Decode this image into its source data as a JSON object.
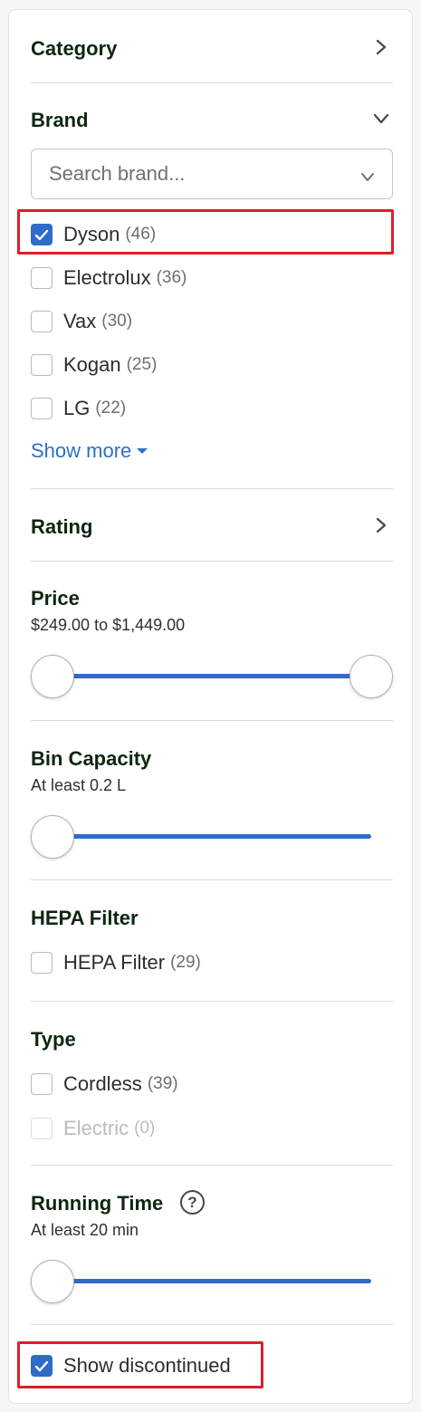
{
  "category": {
    "title": "Category"
  },
  "brand": {
    "title": "Brand",
    "search_placeholder": "Search brand...",
    "options": [
      {
        "label": "Dyson",
        "count": "(46)",
        "checked": true
      },
      {
        "label": "Electrolux",
        "count": "(36)",
        "checked": false
      },
      {
        "label": "Vax",
        "count": "(30)",
        "checked": false
      },
      {
        "label": "Kogan",
        "count": "(25)",
        "checked": false
      },
      {
        "label": "LG",
        "count": "(22)",
        "checked": false
      }
    ],
    "show_more": "Show more"
  },
  "rating": {
    "title": "Rating"
  },
  "price": {
    "title": "Price",
    "range_text": "$249.00 to $1,449.00",
    "min_fraction": 0.0,
    "max_fraction": 1.0
  },
  "bin_capacity": {
    "title": "Bin Capacity",
    "value_text": "At least 0.2 L",
    "fraction": 0.0
  },
  "hepa": {
    "title": "HEPA Filter",
    "options": [
      {
        "label": "HEPA Filter",
        "count": "(29)",
        "checked": false
      }
    ]
  },
  "type": {
    "title": "Type",
    "options": [
      {
        "label": "Cordless",
        "count": "(39)",
        "checked": false,
        "disabled": false
      },
      {
        "label": "Electric",
        "count": "(0)",
        "checked": false,
        "disabled": true
      }
    ]
  },
  "running_time": {
    "title": "Running Time",
    "help_glyph": "?",
    "value_text": "At least 20 min",
    "fraction": 0.0
  },
  "discontinued": {
    "label": "Show discontinued",
    "checked": true
  },
  "colors": {
    "accent": "#2f6bc9",
    "title_text": "#0d2610",
    "highlight": "#dc1f2a",
    "link": "#2d6ec9"
  }
}
